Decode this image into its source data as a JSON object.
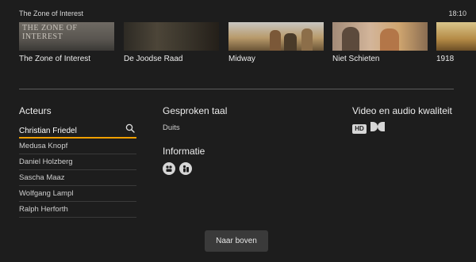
{
  "header": {
    "title": "The Zone of Interest",
    "time": "18:10"
  },
  "related": [
    {
      "label": "The Zone of Interest",
      "poster_text": "THE ZONE OF INTEREST"
    },
    {
      "label": "De Joodse Raad"
    },
    {
      "label": "Midway"
    },
    {
      "label": "Niet Schieten"
    },
    {
      "label": "1918"
    }
  ],
  "actors": {
    "heading": "Acteurs",
    "selected": "Christian Friedel",
    "list": [
      "Medusa Knopf",
      "Daniel Holzberg",
      "Sascha Maaz",
      "Wolfgang Lampl",
      "Ralph Herforth"
    ]
  },
  "language": {
    "heading": "Gesproken taal",
    "value": "Duits"
  },
  "info": {
    "heading": "Informatie",
    "icons": [
      "rating-icon-1",
      "rating-icon-2"
    ]
  },
  "quality": {
    "heading": "Video en audio kwaliteit",
    "hd_label": "HD",
    "icons": [
      "hd-icon",
      "dolby-icon"
    ]
  },
  "buttons": {
    "back_to_top": "Naar boven"
  },
  "colors": {
    "accent": "#f0a000",
    "background": "#1d1d1d"
  }
}
